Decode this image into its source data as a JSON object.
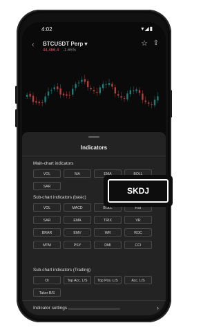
{
  "status": {
    "time": "4:02",
    "icons": "▾◢▮"
  },
  "header": {
    "back": "‹",
    "pair": "BTCUSDT Perp ▾",
    "sub_price": "44,466.4",
    "sub_change": "-1.65%"
  },
  "sheet": {
    "title": "Indicators",
    "main_section": "Main-chart indicators",
    "main_items": [
      "VOL",
      "MA",
      "EMA",
      "BOLL",
      "SAR"
    ],
    "sub_basic_section": "Sub-chart indicators (basic)",
    "sub_basic_items": [
      "VOL",
      "MACD",
      "BOLL",
      "RSI",
      "SAR",
      "EMA",
      "TRIX",
      "VR",
      "BRAR",
      "EMV",
      "WR",
      "ROC",
      "MTM",
      "PSY",
      "DMI",
      "CCI"
    ],
    "sub_trading_section": "Sub-chart indicators (Trading)",
    "sub_trading_items": [
      "OI",
      "Top Acc. L/S",
      "Top Pos. L/S",
      "Acc. L/S",
      "Taker B/S"
    ],
    "settings_label": "Indicator settings",
    "settings_chevron": "›"
  },
  "callout": {
    "label": "SKDJ"
  },
  "colors": {
    "up": "#26a69a",
    "down": "#ef5350",
    "background": "#0a0a0a"
  }
}
